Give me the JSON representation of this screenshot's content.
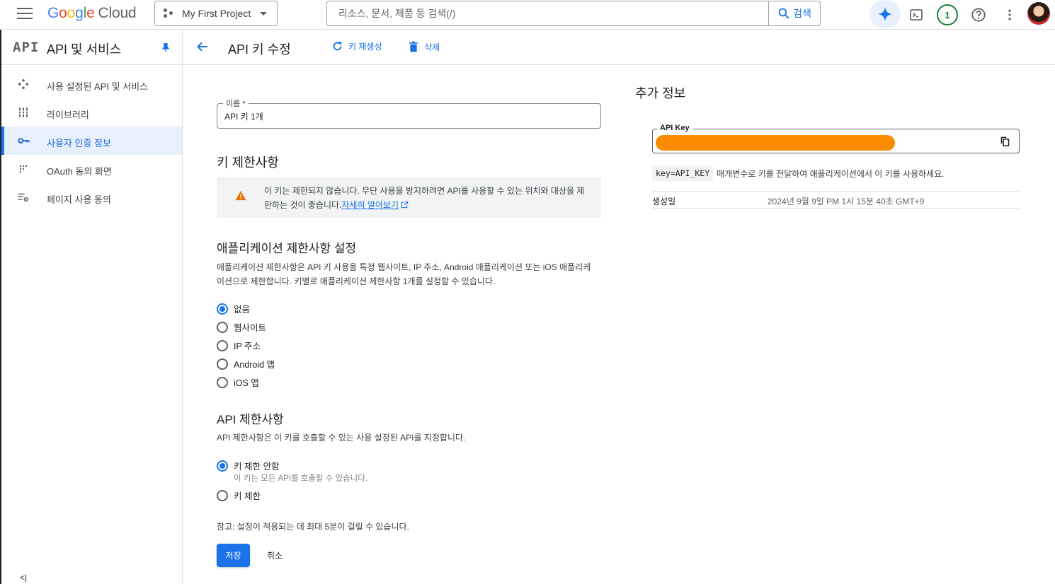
{
  "topbar": {
    "logo_letters": [
      "G",
      "o",
      "o",
      "g",
      "l",
      "e"
    ],
    "logo_product": "Cloud",
    "project": "My First Project",
    "search_placeholder": "리소스, 문서, 제품 등 검색(/)",
    "search_button": "검색",
    "notifications_count": "1"
  },
  "sidebar": {
    "logo": "API",
    "title": "API 및 서비스",
    "items": [
      {
        "label": "사용 설정된 API 및 서비스",
        "icon": "enabled-apis-icon"
      },
      {
        "label": "라이브러리",
        "icon": "library-icon"
      },
      {
        "label": "사용자 인증 정보",
        "icon": "key-icon",
        "active": true
      },
      {
        "label": "OAuth 동의 화면",
        "icon": "oauth-consent-icon"
      },
      {
        "label": "페이지 사용 동의",
        "icon": "page-usage-icon"
      }
    ],
    "collapse_label": "<|"
  },
  "header": {
    "title": "API 키 수정",
    "regenerate": "키 재생성",
    "delete": "삭제"
  },
  "form": {
    "name_label": "이름 *",
    "name_value": "API 키 1개",
    "key_restrictions_title": "키 제한사항",
    "warning_text": "이 키는 제한되지 않습니다. 무단 사용을 방지하려면 API를 사용할 수 있는 위치와 대상을 제한하는 것이 좋습니다.",
    "warning_link": "자세히 알아보기",
    "app_restrictions_title": "애플리케이션 제한사항 설정",
    "app_restrictions_desc_1": "애플리케이션 제한사항은 API 키 사용을 특정 웹사이트, IP 주소, Android 애플리케이션 또는 iOS 애플리케",
    "app_restrictions_desc_2": "이션으로 제한합니다. 키별로 애플리케이션 제한사항 1개를 설정할 수 있습니다.",
    "app_options": [
      {
        "label": "없음",
        "selected": true
      },
      {
        "label": "웹사이트",
        "selected": false
      },
      {
        "label": "IP 주소",
        "selected": false
      },
      {
        "label": "Android 앱",
        "selected": false
      },
      {
        "label": "iOS 앱",
        "selected": false
      }
    ],
    "api_restrictions_title": "API 제한사항",
    "api_restrictions_desc": "API 제한사항은 이 키를 호출할 수 있는 사용 설정된 API를 지정합니다.",
    "api_options": [
      {
        "label": "키 제한 안함",
        "selected": true,
        "hint": "이 키는 모든 API를 호출할 수 있습니다."
      },
      {
        "label": "키 제한",
        "selected": false
      }
    ],
    "note": "참고: 설정이 적용되는 데 최대 5분이 걸릴 수 있습니다.",
    "save": "저장",
    "cancel": "취소"
  },
  "extra": {
    "title": "추가 정보",
    "api_key_label": "API Key",
    "param_code": "key=API_KEY",
    "param_hint": "매개변수로 키를 전달하여 애플리케이션에서 이 키를 사용하세요.",
    "created_label": "생성일",
    "created_value": "2024년 9월 9일 PM 1시 15분 40초 GMT+9"
  },
  "colors": {
    "accent": "#1a73e8",
    "masked_key": "#fb8c00",
    "warning": "#e37400"
  }
}
